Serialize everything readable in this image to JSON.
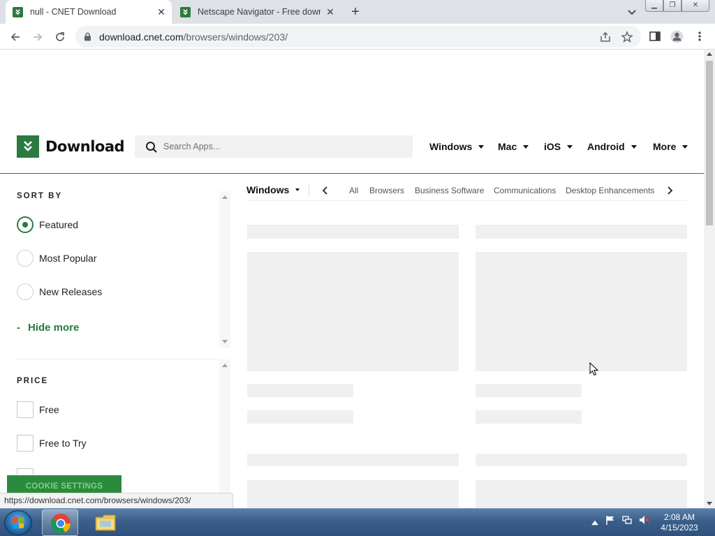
{
  "browser": {
    "tabs": [
      {
        "title": "null - CNET Download",
        "active": true
      },
      {
        "title": "Netscape Navigator - Free downl",
        "active": false
      }
    ],
    "url_host": "download.cnet.com",
    "url_path": "/browsers/windows/203/"
  },
  "site": {
    "logo_text": "Download",
    "search_placeholder": "Search Apps...",
    "nav": [
      "Windows",
      "Mac",
      "iOS",
      "Android",
      "More"
    ]
  },
  "sidebar": {
    "sort_by_label": "SORT BY",
    "sort_options": [
      {
        "label": "Featured",
        "selected": true
      },
      {
        "label": "Most Popular",
        "selected": false
      },
      {
        "label": "New Releases",
        "selected": false
      }
    ],
    "hide_more_label": "Hide more",
    "price_label": "PRICE",
    "price_options": [
      "Free",
      "Free to Try"
    ]
  },
  "category_bar": {
    "platform": "Windows",
    "categories": [
      "All",
      "Browsers",
      "Business Software",
      "Communications",
      "Desktop Enhancements"
    ]
  },
  "cookie_button": "COOKIE SETTINGS",
  "status_url": "https://download.cnet.com/browsers/windows/203/",
  "taskbar": {
    "time": "2:08 AM",
    "date": "4/15/2023"
  },
  "colors": {
    "brand_green": "#2b7a3f",
    "skeleton_gray": "#f0f0f0"
  }
}
